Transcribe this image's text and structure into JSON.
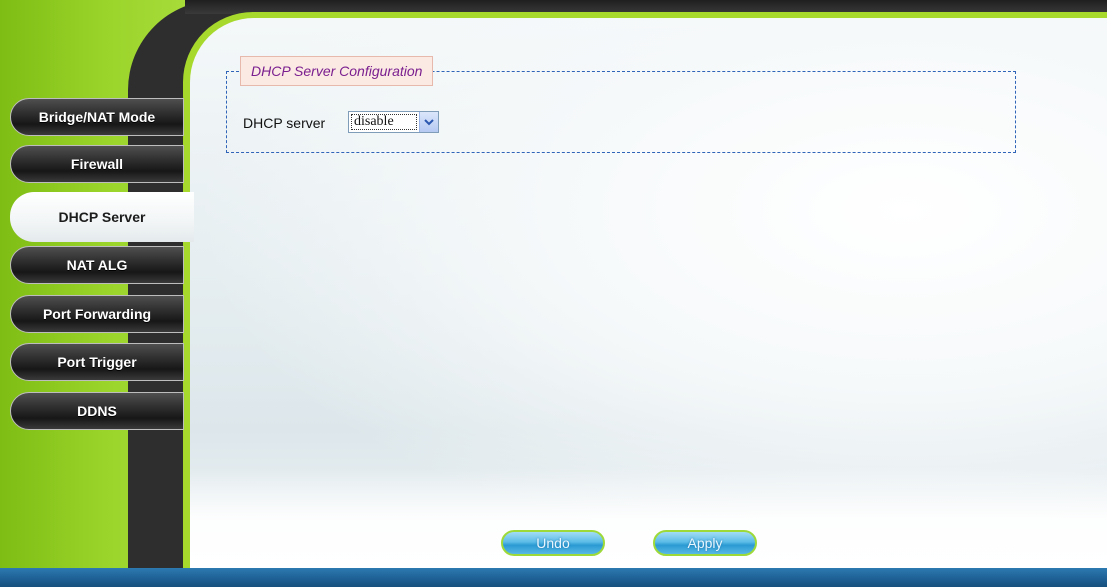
{
  "sidebar": {
    "items": [
      {
        "label": "Bridge/NAT Mode",
        "active": false
      },
      {
        "label": "Firewall",
        "active": false
      },
      {
        "label": "DHCP Server",
        "active": true
      },
      {
        "label": "NAT ALG",
        "active": false
      },
      {
        "label": "Port Forwarding",
        "active": false
      },
      {
        "label": "Port Trigger",
        "active": false
      },
      {
        "label": "DDNS",
        "active": false
      }
    ]
  },
  "main": {
    "section_title": "DHCP Server Configuration",
    "dhcp_server": {
      "label": "DHCP server",
      "selected": "disable"
    }
  },
  "footer": {
    "undo_label": "Undo",
    "apply_label": "Apply"
  },
  "colors": {
    "accent_lime": "#9ad42a",
    "frame_dark": "#2e2e2e",
    "bottom_bar_blue": "#1f6196",
    "legend_text": "#7a1f8f",
    "fieldset_border": "#2f64b8"
  },
  "icons": {
    "select_arrow": "chevron-down-icon"
  }
}
